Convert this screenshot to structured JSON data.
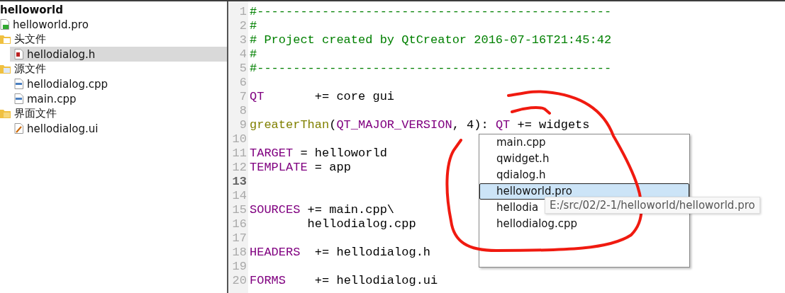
{
  "project_tree": {
    "label": "helloworld",
    "kind": "project",
    "children": [
      {
        "label": "helloworld.pro",
        "kind": "pro",
        "selected": false
      },
      {
        "label": "头文件",
        "kind": "header-folder",
        "selected": false,
        "children": [
          {
            "label": "hellodialog.h",
            "kind": "header",
            "selected": true
          }
        ]
      },
      {
        "label": "源文件",
        "kind": "source-folder",
        "selected": false,
        "children": [
          {
            "label": "hellodialog.cpp",
            "kind": "source",
            "selected": false
          },
          {
            "label": "main.cpp",
            "kind": "source",
            "selected": false
          }
        ]
      },
      {
        "label": "界面文件",
        "kind": "form-folder",
        "selected": false,
        "children": [
          {
            "label": "hellodialog.ui",
            "kind": "form",
            "selected": false
          }
        ]
      }
    ]
  },
  "editor": {
    "lines": [
      {
        "number": "1",
        "current": false,
        "tokens": [
          {
            "kind": "comment",
            "text": "#-------------------------------------------------"
          }
        ]
      },
      {
        "number": "2",
        "current": false,
        "tokens": [
          {
            "kind": "comment",
            "text": "#"
          }
        ]
      },
      {
        "number": "3",
        "current": false,
        "tokens": [
          {
            "kind": "comment",
            "text": "# Project created by QtCreator 2016-07-16T21:45:42"
          }
        ]
      },
      {
        "number": "4",
        "current": false,
        "tokens": [
          {
            "kind": "comment",
            "text": "#"
          }
        ]
      },
      {
        "number": "5",
        "current": false,
        "tokens": [
          {
            "kind": "comment",
            "text": "#-------------------------------------------------"
          }
        ]
      },
      {
        "number": "6",
        "current": false
      },
      {
        "number": "7",
        "current": false,
        "tokens": [
          {
            "kind": "variable",
            "text": "QT"
          },
          {
            "kind": "plain",
            "text": "       += core gui"
          }
        ]
      },
      {
        "number": "8",
        "current": false
      },
      {
        "number": "9",
        "current": false,
        "tokens": [
          {
            "kind": "function",
            "text": "greaterThan"
          },
          {
            "kind": "plain",
            "text": "("
          },
          {
            "kind": "variable",
            "text": "QT_MAJOR_VERSION"
          },
          {
            "kind": "plain",
            "text": ", 4): "
          },
          {
            "kind": "variable",
            "text": "QT"
          },
          {
            "kind": "plain",
            "text": " += widgets"
          }
        ]
      },
      {
        "number": "10",
        "current": false
      },
      {
        "number": "11",
        "current": false,
        "tokens": [
          {
            "kind": "variable",
            "text": "TARGET"
          },
          {
            "kind": "plain",
            "text": " = helloworld"
          }
        ]
      },
      {
        "number": "12",
        "current": false,
        "tokens": [
          {
            "kind": "variable",
            "text": "TEMPLATE"
          },
          {
            "kind": "plain",
            "text": " = app"
          }
        ]
      },
      {
        "number": "13",
        "current": true
      },
      {
        "number": "14",
        "current": false
      },
      {
        "number": "15",
        "current": false,
        "tokens": [
          {
            "kind": "variable",
            "text": "SOURCES"
          },
          {
            "kind": "plain",
            "text": " += main.cpp\\"
          }
        ]
      },
      {
        "number": "16",
        "current": false,
        "tokens": [
          {
            "kind": "plain",
            "text": "        hellodialog.cpp"
          }
        ]
      },
      {
        "number": "17",
        "current": false
      },
      {
        "number": "18",
        "current": false,
        "tokens": [
          {
            "kind": "variable",
            "text": "HEADERS"
          },
          {
            "kind": "plain",
            "text": "  += hellodialog.h"
          }
        ]
      },
      {
        "number": "19",
        "current": false
      },
      {
        "number": "20",
        "current": false,
        "tokens": [
          {
            "kind": "variable",
            "text": "FORMS"
          },
          {
            "kind": "plain",
            "text": "    += hellodialog.ui"
          }
        ]
      }
    ]
  },
  "completion_popup": {
    "items": [
      {
        "label": "main.cpp",
        "selected": false
      },
      {
        "label": "qwidget.h",
        "selected": false
      },
      {
        "label": "qdialog.h",
        "selected": false
      },
      {
        "label": "helloworld.pro",
        "selected": true
      },
      {
        "label": "hellodia",
        "selected": false
      },
      {
        "label": "hellodialog.cpp",
        "selected": false
      }
    ]
  },
  "tooltip": {
    "text": "E:/src/02/2-1/helloworld/helloworld.pro"
  }
}
